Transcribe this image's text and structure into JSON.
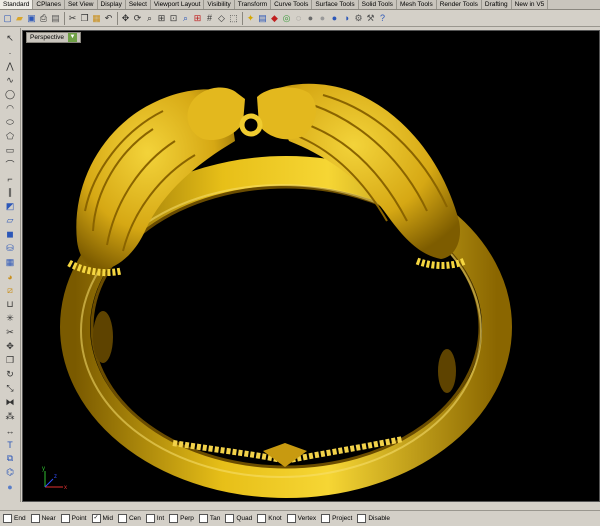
{
  "tabs": [
    "Standard",
    "CPlanes",
    "Set View",
    "Display",
    "Select",
    "Viewport Layout",
    "Visibility",
    "Transform",
    "Curve Tools",
    "Surface Tools",
    "Solid Tools",
    "Mesh Tools",
    "Render Tools",
    "Drafting",
    "New in V5"
  ],
  "active_tab": "Standard",
  "toolbar_icons": [
    {
      "name": "new-file-icon",
      "glyph": "▢",
      "color": "#2c57b8"
    },
    {
      "name": "open-folder-icon",
      "glyph": "▰",
      "color": "#d9a62b"
    },
    {
      "name": "save-icon",
      "glyph": "▣",
      "color": "#2c57b8"
    },
    {
      "name": "print-icon",
      "glyph": "⎙",
      "color": "#333333"
    },
    {
      "name": "import-icon",
      "glyph": "▤",
      "color": "#555555"
    },
    {
      "name": "cut-icon",
      "glyph": "✂",
      "color": "#333333"
    },
    {
      "name": "copy-icon",
      "glyph": "❐",
      "color": "#333333"
    },
    {
      "name": "paste-icon",
      "glyph": "▦",
      "color": "#c9901e"
    },
    {
      "name": "undo-icon",
      "glyph": "↶",
      "color": "#333333"
    },
    {
      "name": "pan-icon",
      "glyph": "✥",
      "color": "#333333"
    },
    {
      "name": "rotate-view-icon",
      "glyph": "⟳",
      "color": "#333333"
    },
    {
      "name": "zoom-icon",
      "glyph": "⌕",
      "color": "#333333"
    },
    {
      "name": "zoom-window-icon",
      "glyph": "⊞",
      "color": "#333333"
    },
    {
      "name": "zoom-extents-icon",
      "glyph": "⊡",
      "color": "#333333"
    },
    {
      "name": "zoom-selected-icon",
      "glyph": "⌕",
      "color": "#2c57b8"
    },
    {
      "name": "four-viewports-icon",
      "glyph": "⊞",
      "color": "#c02020"
    },
    {
      "name": "grid-icon",
      "glyph": "#",
      "color": "#333333"
    },
    {
      "name": "cplane-icon",
      "glyph": "◇",
      "color": "#333333"
    },
    {
      "name": "select-all-icon",
      "glyph": "⬚",
      "color": "#333333"
    },
    {
      "name": "lights-icon",
      "glyph": "✦",
      "color": "#d4a600"
    },
    {
      "name": "layers-icon",
      "glyph": "▤",
      "color": "#2c57b8"
    },
    {
      "name": "properties-icon",
      "glyph": "◆",
      "color": "#c02020"
    },
    {
      "name": "color-wheel-icon",
      "glyph": "◎",
      "color": "#3a9a3a"
    },
    {
      "name": "wireframe-sphere-icon",
      "glyph": "◌",
      "color": "#555555"
    },
    {
      "name": "shaded-sphere-icon",
      "glyph": "●",
      "color": "#6a6a6a"
    },
    {
      "name": "rendered-sphere-icon",
      "glyph": "●",
      "color": "#999999"
    },
    {
      "name": "render-icon",
      "glyph": "●",
      "color": "#2c57b8"
    },
    {
      "name": "material-icon",
      "glyph": "◑",
      "color": "#2c57b8"
    },
    {
      "name": "tools-icon",
      "glyph": "⚙",
      "color": "#555555"
    },
    {
      "name": "options-icon",
      "glyph": "⚒",
      "color": "#555555"
    },
    {
      "name": "help-icon",
      "glyph": "?",
      "color": "#2c57b8"
    }
  ],
  "left_tools": [
    {
      "name": "select-arrow-icon",
      "glyph": "↖",
      "color": "#333333"
    },
    {
      "name": "point-icon",
      "glyph": "·",
      "color": "#333333"
    },
    {
      "name": "polyline-icon",
      "glyph": "⋀",
      "color": "#333333"
    },
    {
      "name": "curve-icon",
      "glyph": "∿",
      "color": "#333333"
    },
    {
      "name": "circle-icon",
      "glyph": "◯",
      "color": "#333333"
    },
    {
      "name": "arc-icon",
      "glyph": "◠",
      "color": "#333333"
    },
    {
      "name": "ellipse-icon",
      "glyph": "⬭",
      "color": "#333333"
    },
    {
      "name": "polygon-icon",
      "glyph": "⬠",
      "color": "#333333"
    },
    {
      "name": "rectangle-icon",
      "glyph": "▭",
      "color": "#333333"
    },
    {
      "name": "freeform-icon",
      "glyph": "⌒",
      "color": "#333333"
    },
    {
      "name": "fillet-curve-icon",
      "glyph": "⌐",
      "color": "#333333"
    },
    {
      "name": "offset-icon",
      "glyph": "∥",
      "color": "#333333"
    },
    {
      "name": "surface-icon",
      "glyph": "◩",
      "color": "#2c57b8"
    },
    {
      "name": "extrude-icon",
      "glyph": "▱",
      "color": "#2c57b8"
    },
    {
      "name": "solid-box-icon",
      "glyph": "◼",
      "color": "#2c57b8"
    },
    {
      "name": "cylinder-icon",
      "glyph": "⛁",
      "color": "#2c57b8"
    },
    {
      "name": "mesh-icon",
      "glyph": "▦",
      "color": "#2c57b8"
    },
    {
      "name": "boolean-icon",
      "glyph": "◕",
      "color": "#c9901e"
    },
    {
      "name": "split-icon",
      "glyph": "⧄",
      "color": "#c9901e"
    },
    {
      "name": "join-icon",
      "glyph": "⊔",
      "color": "#333333"
    },
    {
      "name": "explode-icon",
      "glyph": "✳",
      "color": "#333333"
    },
    {
      "name": "trim-icon",
      "glyph": "✂",
      "color": "#333333"
    },
    {
      "name": "move-icon",
      "glyph": "✥",
      "color": "#333333"
    },
    {
      "name": "copy-icon",
      "glyph": "❐",
      "color": "#333333"
    },
    {
      "name": "rotate-icon",
      "glyph": "↻",
      "color": "#333333"
    },
    {
      "name": "scale-icon",
      "glyph": "⤡",
      "color": "#333333"
    },
    {
      "name": "mirror-icon",
      "glyph": "⧓",
      "color": "#333333"
    },
    {
      "name": "array-icon",
      "glyph": "⁂",
      "color": "#333333"
    },
    {
      "name": "dimension-icon",
      "glyph": "↔",
      "color": "#333333"
    },
    {
      "name": "text-icon",
      "glyph": "T",
      "color": "#2c57b8"
    },
    {
      "name": "block-icon",
      "glyph": "⧉",
      "color": "#2c57b8"
    },
    {
      "name": "analyze-icon",
      "glyph": "⌬",
      "color": "#2c57b8"
    },
    {
      "name": "render-sphere-icon",
      "glyph": "●",
      "color": "#5a7ec8"
    }
  ],
  "viewport": {
    "label": "Perspective"
  },
  "axes": {
    "x": "x",
    "y": "y",
    "z": "z"
  },
  "snaps": [
    {
      "label": "End",
      "checked": false
    },
    {
      "label": "Near",
      "checked": false
    },
    {
      "label": "Point",
      "checked": false
    },
    {
      "label": "Mid",
      "checked": true
    },
    {
      "label": "Cen",
      "checked": false
    },
    {
      "label": "Int",
      "checked": false
    },
    {
      "label": "Perp",
      "checked": false
    },
    {
      "label": "Tan",
      "checked": false
    },
    {
      "label": "Quad",
      "checked": false
    },
    {
      "label": "Knot",
      "checked": false
    },
    {
      "label": "Vertex",
      "checked": false
    },
    {
      "label": "Project",
      "checked": false
    },
    {
      "label": "Disable",
      "checked": false
    }
  ]
}
